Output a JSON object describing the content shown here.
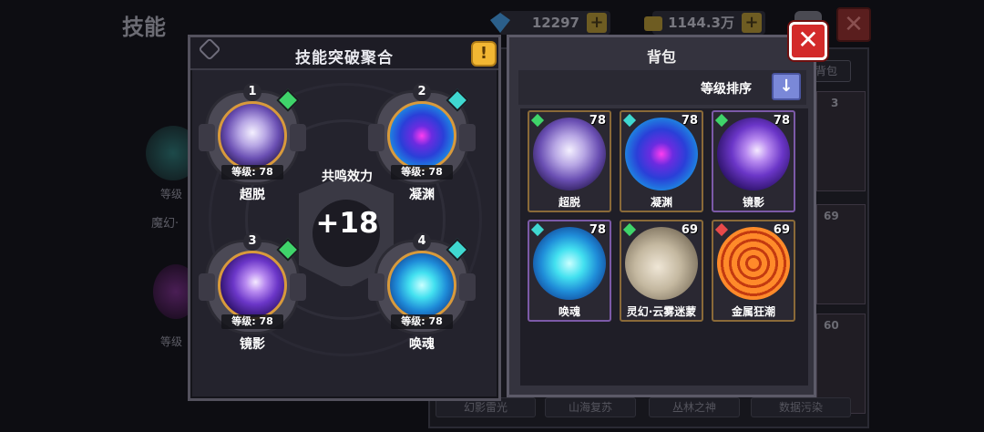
{
  "background": {
    "title": "技能",
    "resources": [
      {
        "icon": "diamond-icon",
        "value": "12297"
      },
      {
        "icon": "coin-bag-icon",
        "value": "1144.3万"
      }
    ],
    "tab_label": "背包",
    "side_labels": [
      "等级",
      "魔幻·",
      "等级"
    ],
    "right_levels": [
      "3",
      "69",
      "60"
    ],
    "bottom_tabs": [
      "幻影雷光",
      "山海复苏",
      "丛林之神",
      "数据污染"
    ]
  },
  "left_panel": {
    "title": "技能突破聚合",
    "alert_icon": "!",
    "center_label": "共鸣效力",
    "center_value": "+18",
    "slots": [
      {
        "index": "1",
        "level_text": "等级: 78",
        "name": "超脱",
        "orb": "crystal",
        "gem_color": "#3fd46a"
      },
      {
        "index": "2",
        "level_text": "等级: 78",
        "name": "凝渊",
        "orb": "void",
        "gem_color": "#3fd8d0"
      },
      {
        "index": "3",
        "level_text": "等级: 78",
        "name": "镜影",
        "orb": "mirror",
        "gem_color": "#3fd46a"
      },
      {
        "index": "4",
        "level_text": "等级: 78",
        "name": "唤魂",
        "orb": "soul",
        "gem_color": "#3fd8d0"
      }
    ]
  },
  "right_panel": {
    "title": "背包",
    "sort_label": "等级排序",
    "sort_icon": "↓",
    "items": [
      {
        "name": "超脱",
        "level": "78",
        "orb": "crystal",
        "gem_color": "#3fd46a",
        "border": "gold"
      },
      {
        "name": "凝渊",
        "level": "78",
        "orb": "void",
        "gem_color": "#3fd8d0",
        "border": "gold"
      },
      {
        "name": "镜影",
        "level": "78",
        "orb": "mirror",
        "gem_color": "#3fd46a",
        "border": "purple"
      },
      {
        "name": "唤魂",
        "level": "78",
        "orb": "soul",
        "gem_color": "#3fd8d0",
        "border": "purple"
      },
      {
        "name": "灵幻·云雾迷蒙",
        "level": "69",
        "orb": "fog",
        "gem_color": "#3fd46a",
        "border": "gold"
      },
      {
        "name": "金属狂潮",
        "level": "69",
        "orb": "metal",
        "gem_color": "#e84a4a",
        "border": "gold"
      }
    ]
  },
  "close_label": "✕"
}
